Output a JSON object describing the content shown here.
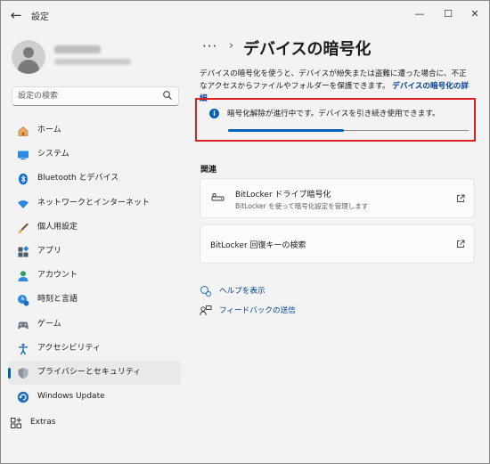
{
  "window": {
    "title": "設定",
    "minimize_glyph": "—",
    "maximize_glyph": "☐",
    "close_glyph": "✕",
    "back_glyph": "←"
  },
  "search": {
    "placeholder": "設定の検索"
  },
  "sidebar": {
    "items": [
      {
        "label": "ホーム",
        "icon": "home-icon"
      },
      {
        "label": "システム",
        "icon": "system-icon"
      },
      {
        "label": "Bluetooth とデバイス",
        "icon": "bluetooth-icon"
      },
      {
        "label": "ネットワークとインターネット",
        "icon": "wifi-icon"
      },
      {
        "label": "個人用設定",
        "icon": "brush-icon"
      },
      {
        "label": "アプリ",
        "icon": "apps-icon"
      },
      {
        "label": "アカウント",
        "icon": "account-icon"
      },
      {
        "label": "時刻と言語",
        "icon": "time-language-icon"
      },
      {
        "label": "ゲーム",
        "icon": "gamepad-icon"
      },
      {
        "label": "アクセシビリティ",
        "icon": "accessibility-icon"
      },
      {
        "label": "プライバシーとセキュリティ",
        "icon": "shield-icon",
        "selected": true
      },
      {
        "label": "Windows Update",
        "icon": "windows-update-icon"
      }
    ],
    "extras_label": "Extras"
  },
  "breadcrumb": {
    "more": "···",
    "separator": "›",
    "title": "デバイスの暗号化"
  },
  "description": {
    "text": "デバイスの暗号化を使うと、デバイスが紛失または盗難に遭った場合に、不正なアクセスからファイルやフォルダーを保護できます。",
    "link": "デバイスの暗号化の詳細"
  },
  "status": {
    "message": "暗号化解除が進行中です。デバイスを引き続き使用できます。",
    "progress": 0.48
  },
  "related": {
    "label": "関連",
    "bitlocker_title": "BitLocker ドライブ暗号化",
    "bitlocker_subtitle": "BitLocker を使って暗号化設定を管理します",
    "recovery_title": "BitLocker 回復キーの検索"
  },
  "help": {
    "get_help": "ヘルプを表示",
    "feedback": "フィードバックの送信"
  },
  "colors": {
    "accent": "#005fb8",
    "highlight_border": "#e0201f",
    "link": "#003e92"
  }
}
